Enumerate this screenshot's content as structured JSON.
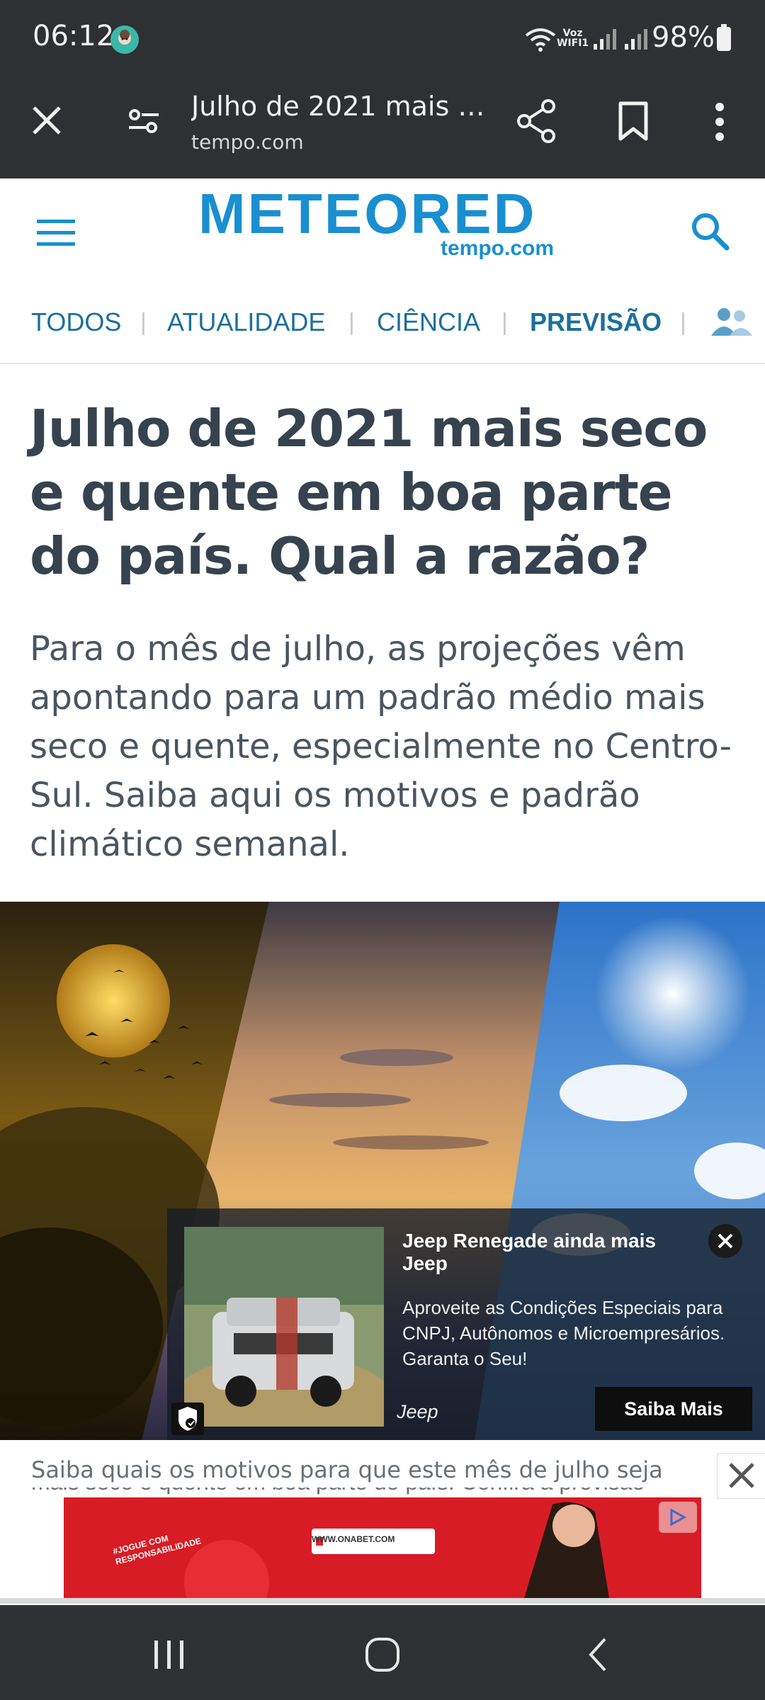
{
  "status_bar": {
    "time": "06:12",
    "network_label_top": "Voz",
    "network_label_bottom": "WIFI1",
    "battery": "98%"
  },
  "browser": {
    "title": "Julho de 2021 mais s…",
    "domain": "tempo.com",
    "icons": [
      "close-icon",
      "site-settings-icon",
      "share-icon",
      "bookmark-icon",
      "more-vert-icon"
    ]
  },
  "site": {
    "logo": "METEORED",
    "logo_sub": "tempo.com",
    "nav": [
      "TODOS",
      "ATUALIDADE",
      "CIÊNCIA",
      "PREVISÃO"
    ]
  },
  "article": {
    "headline": "Julho de 2021 mais seco e quente em boa parte do país. Qual a razão?",
    "summary": "Para o mês de julho, as projeções vêm apontando para um padrão médio mais seco e quente, especialmente no Centro-Sul. Saiba aqui os motivos e padrão climático semanal.",
    "caption": "Saiba quais os motivos para que este mês de julho seja",
    "caption_cut": "mais seco e quente em boa parte do país. Confira a previsão"
  },
  "ad": {
    "title": "Jeep Renegade ainda mais Jeep",
    "description": "Aproveite as Condições Especiais para CNPJ, Autônomos e Microempresários. Garanta o Seu!",
    "brand": "Jeep",
    "cta": "Saiba Mais"
  },
  "banner": {
    "url": "WWW.ONABET.COM",
    "badge": "#JOGUE COM RESPONSABILIDADE"
  },
  "colors": {
    "chrome": "#2f3033",
    "brand": "#1a8fd0",
    "nav_text": "#1d6f9a",
    "headline": "#36434f",
    "banner_red": "#e3202a"
  }
}
